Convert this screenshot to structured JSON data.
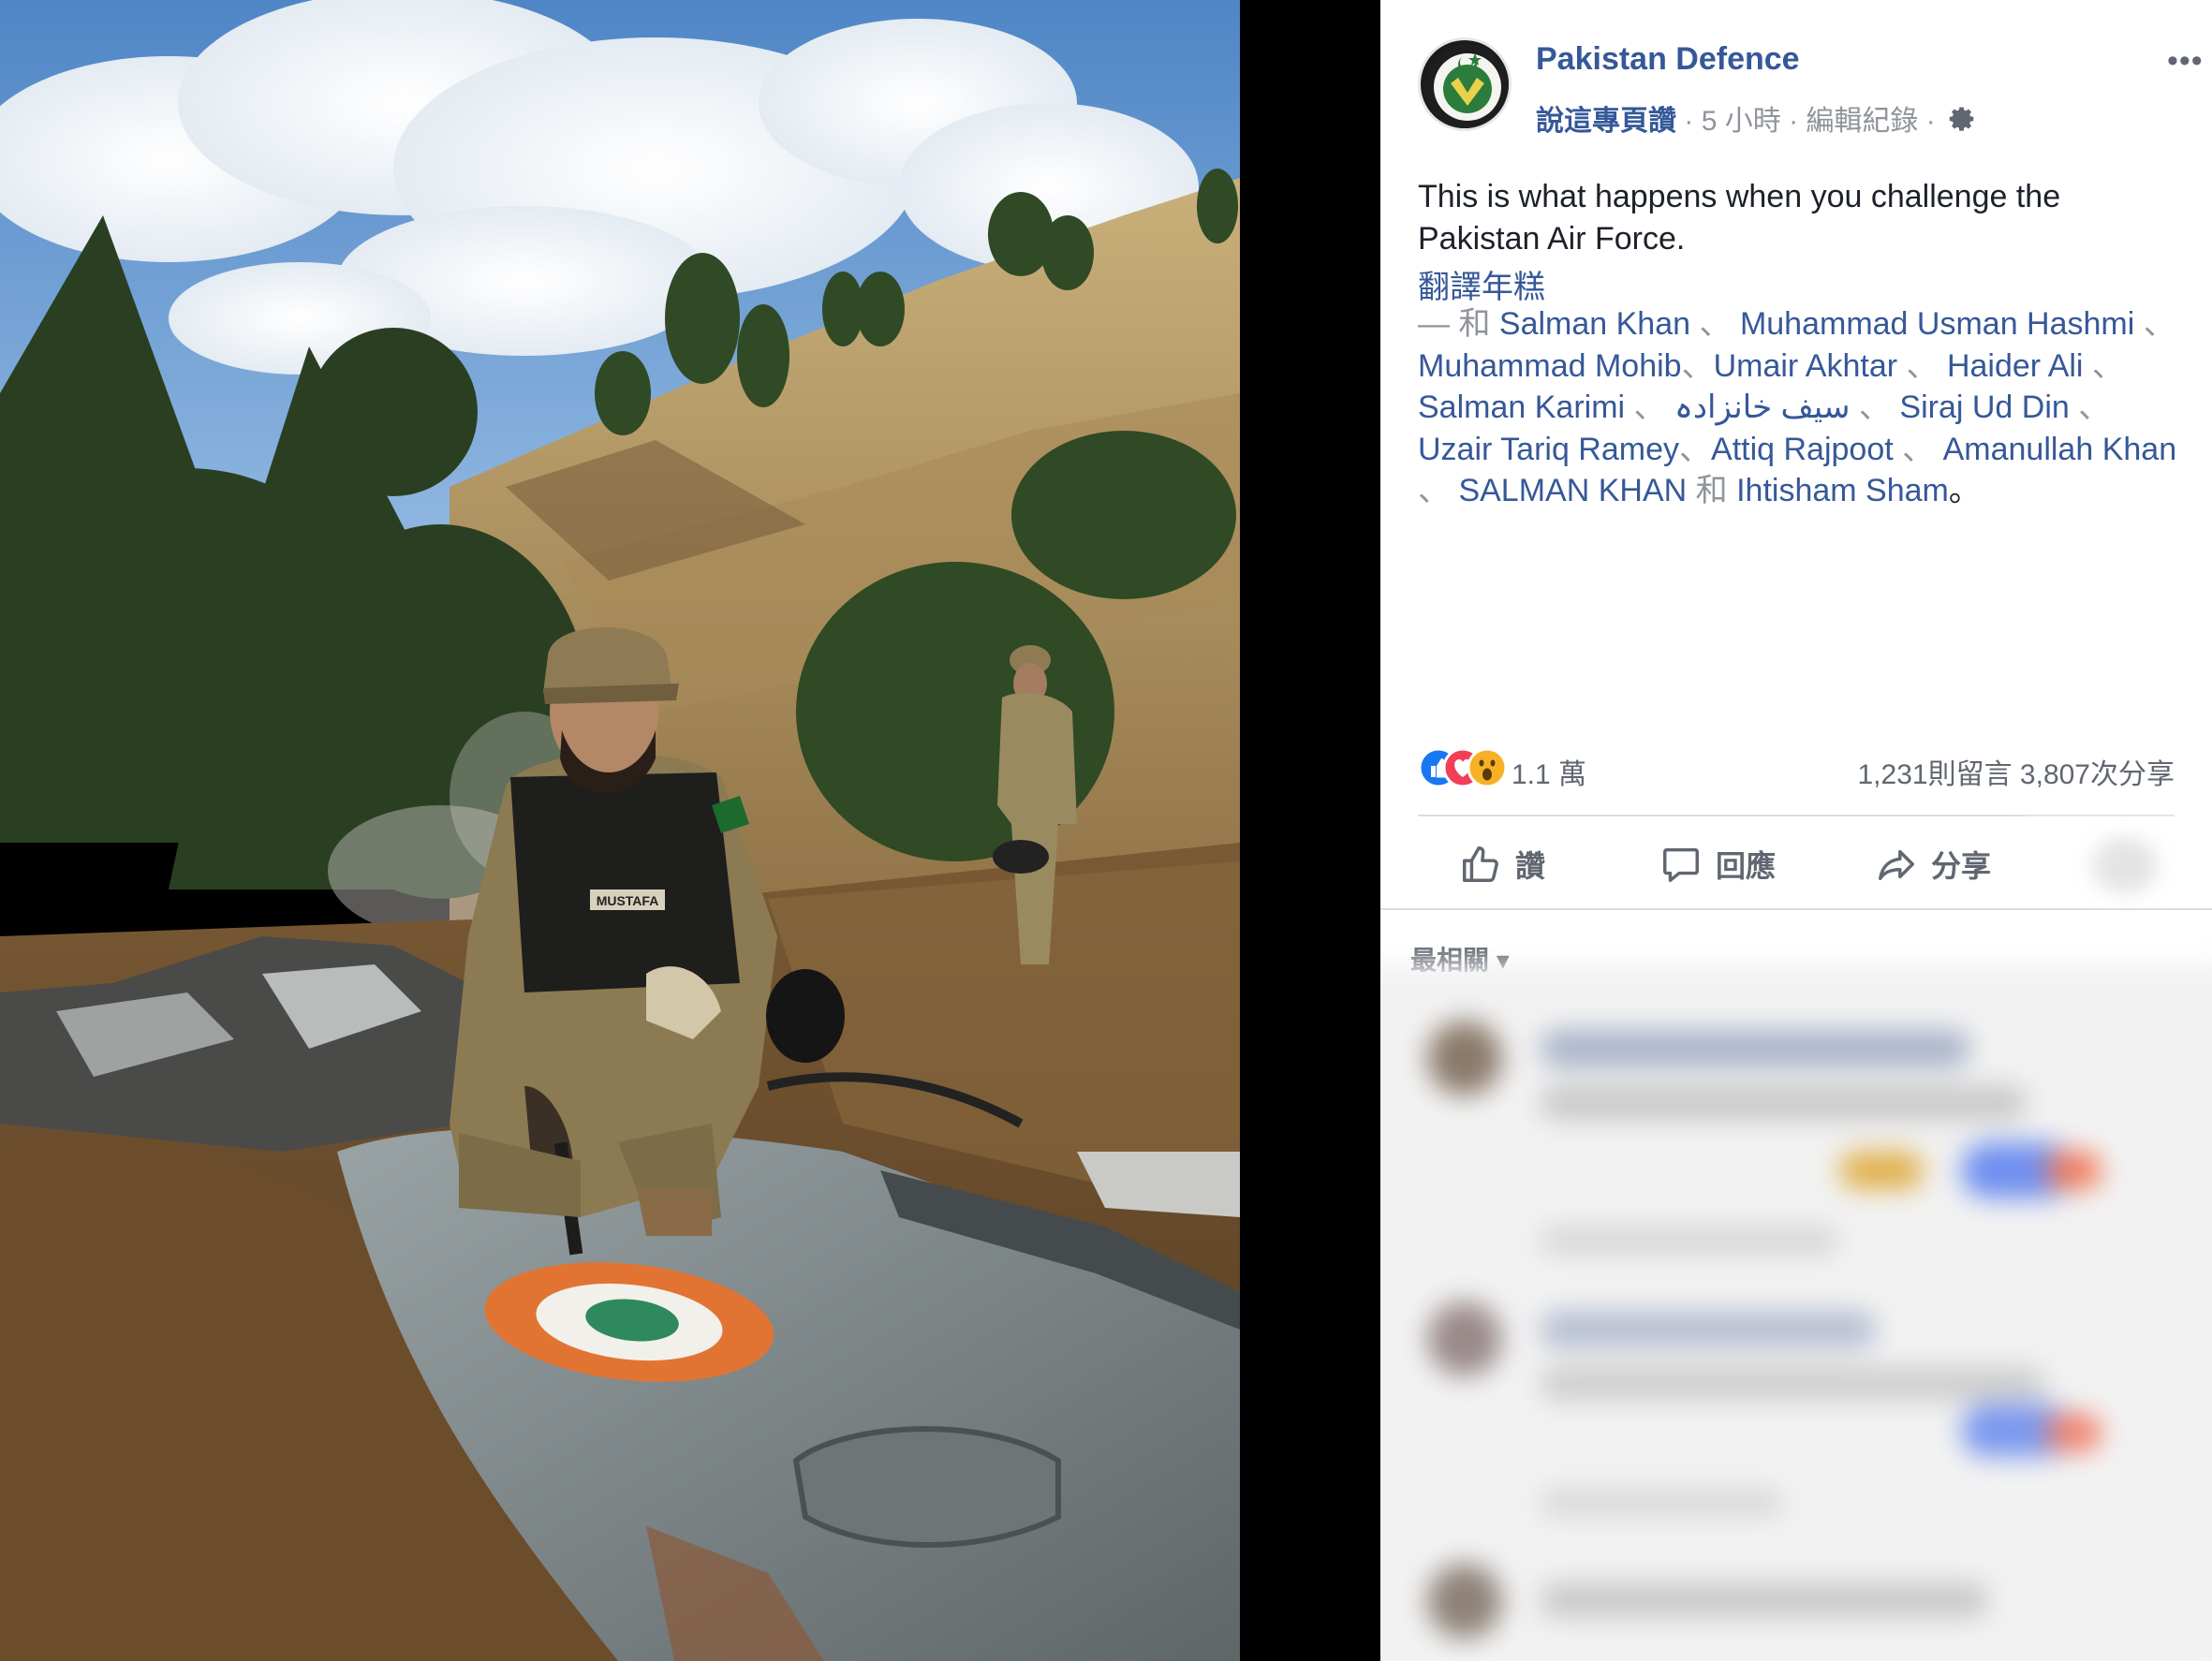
{
  "post": {
    "page_name": "Pakistan Defence",
    "like_page": "說這專頁讚",
    "separator": "·",
    "time": "5 小時",
    "edit_history": "編輯紀錄",
    "more": "•••",
    "text_line1": "This is what happens when you challenge the",
    "text_line2": "Pakistan Air Force.",
    "translate": "翻譯年糕",
    "tags_prefix": "— 和",
    "tagged": [
      "Salman Khan",
      "Muhammad Usman Hashmi",
      "Muhammad Mohib",
      "Umair Akhtar",
      "Haider Ali",
      "Salman Karimi",
      "سیف خانزادہ",
      "Siraj Ud Din",
      "Uzair Tariq Ramey",
      "Attiq Rajpoot",
      "Amanullah Khan",
      "SALMAN KHAN",
      "Ihtisham Sham"
    ],
    "tag_and": "和",
    "tag_end": "。"
  },
  "engagement": {
    "reaction_count": "1.1 萬",
    "comments": "1,231則留言",
    "shares": "3,807次分享"
  },
  "actions": {
    "like": "讚",
    "comment": "回應",
    "share": "分享"
  },
  "comments_section": {
    "sort_label": "最相關 ▾"
  },
  "photo": {
    "uniform_name_tag": "MUSTAFA"
  },
  "colors": {
    "link": "#365899",
    "muted": "#90949c",
    "text": "#1d2129",
    "like_blue": "#1877f2",
    "love_red": "#f33e58",
    "wow_yellow": "#f7b125"
  }
}
